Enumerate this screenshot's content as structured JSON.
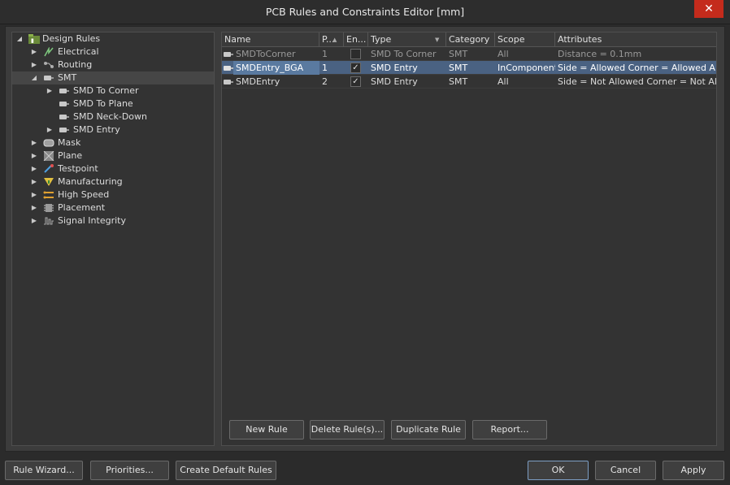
{
  "window": {
    "title": "PCB Rules and Constraints Editor [mm]",
    "close_glyph": "✕"
  },
  "tree": {
    "items": [
      {
        "label": "Design Rules",
        "icon": "design-rules-icon",
        "expanded": true,
        "level": 0
      },
      {
        "label": "Electrical",
        "icon": "electrical-icon",
        "expanded": false,
        "level": 1
      },
      {
        "label": "Routing",
        "icon": "routing-icon",
        "expanded": false,
        "level": 1
      },
      {
        "label": "SMT",
        "icon": "smt-icon",
        "expanded": true,
        "level": 1,
        "selected": true
      },
      {
        "label": "SMD To Corner",
        "icon": "smd-rule-icon",
        "expanded": false,
        "level": 2
      },
      {
        "label": "SMD To Plane",
        "icon": "smd-rule-icon",
        "level": 2
      },
      {
        "label": "SMD Neck-Down",
        "icon": "smd-rule-icon",
        "level": 2
      },
      {
        "label": "SMD Entry",
        "icon": "smd-rule-icon",
        "expanded": false,
        "level": 2
      },
      {
        "label": "Mask",
        "icon": "mask-icon",
        "expanded": false,
        "level": 1
      },
      {
        "label": "Plane",
        "icon": "plane-icon",
        "expanded": false,
        "level": 1
      },
      {
        "label": "Testpoint",
        "icon": "testpoint-icon",
        "expanded": false,
        "level": 1
      },
      {
        "label": "Manufacturing",
        "icon": "manufacturing-icon",
        "expanded": false,
        "level": 1
      },
      {
        "label": "High Speed",
        "icon": "high-speed-icon",
        "expanded": false,
        "level": 1
      },
      {
        "label": "Placement",
        "icon": "placement-icon",
        "expanded": false,
        "level": 1
      },
      {
        "label": "Signal Integrity",
        "icon": "signal-integrity-icon",
        "expanded": false,
        "level": 1
      }
    ]
  },
  "grid": {
    "columns": [
      "Name",
      "P...",
      "En...",
      "Type",
      "Category",
      "Scope",
      "Attributes"
    ],
    "rows": [
      {
        "name": "SMDToCorner",
        "priority": "1",
        "enabled": false,
        "type": "SMD To Corner",
        "category": "SMT",
        "scope": "All",
        "attributes": "Distance = 0.1mm",
        "selected": false
      },
      {
        "name": "SMDEntry_BGA",
        "priority": "1",
        "enabled": true,
        "type": "SMD Entry",
        "category": "SMT",
        "scope": "InComponent",
        "attributes": "Side = Allowed  Corner = Allowed  An",
        "selected": true
      },
      {
        "name": "SMDEntry",
        "priority": "2",
        "enabled": true,
        "type": "SMD Entry",
        "category": "SMT",
        "scope": "All",
        "attributes": "Side = Not Allowed  Corner = Not Allo",
        "selected": false
      }
    ]
  },
  "grid_buttons": {
    "new_rule": "New Rule",
    "delete_rules": "Delete Rule(s)...",
    "duplicate_rule": "Duplicate Rule",
    "report": "Report..."
  },
  "footer": {
    "rule_wizard": "Rule Wizard...",
    "priorities": "Priorities...",
    "create_default_rules": "Create Default Rules",
    "ok": "OK",
    "cancel": "Cancel",
    "apply": "Apply"
  },
  "colors": {
    "selection": "#4a6282",
    "close": "#c42b1c",
    "background": "#3c3c3c"
  }
}
